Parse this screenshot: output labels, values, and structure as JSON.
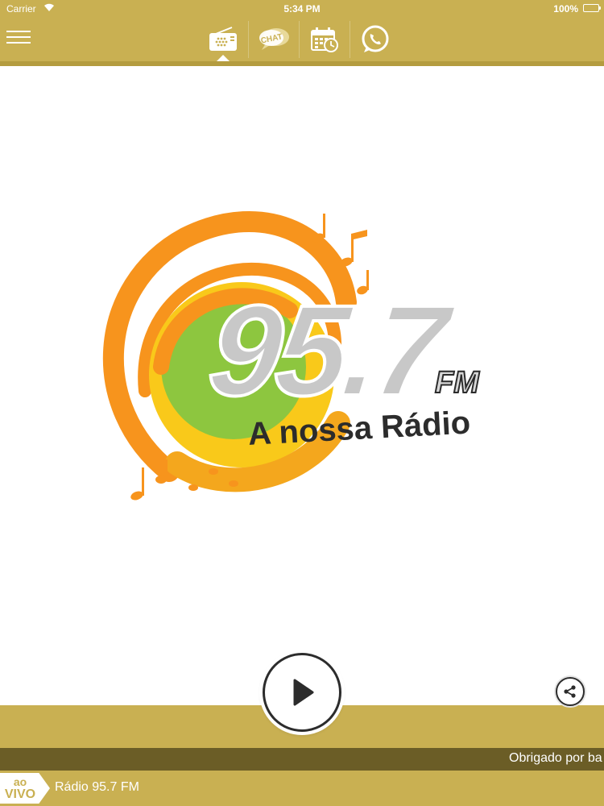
{
  "status_bar": {
    "carrier": "Carrier",
    "time": "5:34 PM",
    "battery": "100%"
  },
  "tabs": [
    {
      "name": "radio",
      "icon": "radio-icon",
      "active": true
    },
    {
      "name": "chat",
      "icon": "chat-icon",
      "label": "CHAT"
    },
    {
      "name": "schedule",
      "icon": "calendar-clock-icon"
    },
    {
      "name": "whatsapp",
      "icon": "whatsapp-icon"
    }
  ],
  "logo": {
    "frequency": "95.7",
    "band": "FM",
    "slogan": "A nossa Rádio"
  },
  "player": {
    "play_icon": "play-icon",
    "share_icon": "share-icon",
    "ticker_text": "Obrigado por ba",
    "live_badge_top": "ao",
    "live_badge_bottom": "VIVO",
    "station_name": "Rádio 95.7 FM"
  },
  "colors": {
    "brand_gold": "#c9b052",
    "ticker_bg": "#6b5d26",
    "logo_orange": "#f7941d",
    "logo_green": "#8dc63f",
    "logo_yellow": "#f9c91a"
  }
}
